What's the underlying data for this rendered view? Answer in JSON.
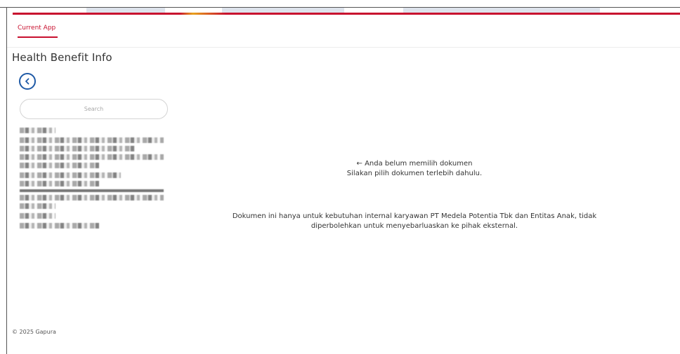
{
  "theme": {
    "accent": "#c8102e",
    "secondary_accent": "#e8a21c",
    "back_button": "#1f5aa6"
  },
  "tabs": [
    {
      "label": "Current App",
      "active": true
    }
  ],
  "page": {
    "title": "Health Benefit Info"
  },
  "sidebar": {
    "back_icon": "chevron-left-icon",
    "search": {
      "placeholder": "Search",
      "value": ""
    },
    "documents": [
      {
        "label": ""
      },
      {
        "label": ""
      },
      {
        "label": ""
      },
      {
        "label": ""
      },
      {
        "label": ""
      }
    ]
  },
  "main": {
    "empty_state": {
      "line1": "← Anda belum memilih dokumen",
      "line2": "Silakan pilih dokumen terlebih dahulu."
    },
    "notice": {
      "line1": "Dokumen ini hanya untuk kebutuhan internal karyawan PT Medela Potentia Tbk dan Entitas Anak, tidak",
      "line2": "diperbolehkan untuk menyebarluaskan ke pihak eksternal."
    }
  },
  "footer": {
    "copyright": "© 2025 Gapura"
  }
}
